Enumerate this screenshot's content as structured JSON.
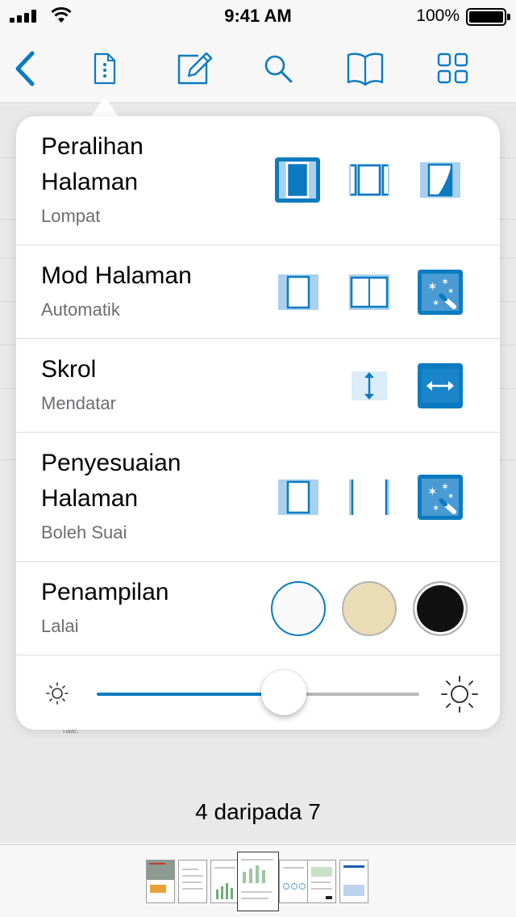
{
  "status_bar": {
    "time": "9:41 AM",
    "battery": "100%"
  },
  "toolbar": {
    "buttons": [
      "back-icon",
      "document-info-icon",
      "annotate-icon",
      "search-icon",
      "bookmark-icon",
      "thumbnails-grid-icon"
    ]
  },
  "view_settings": {
    "rows": [
      {
        "title_line1": "Peralihan",
        "title_line2": "Halaman",
        "value": "Lompat",
        "options": [
          "jump",
          "continuous",
          "page-curl"
        ],
        "selected": 0
      },
      {
        "title_line1": "Mod Halaman",
        "title_line2": "",
        "value": "Automatik",
        "options": [
          "single-page",
          "double-page",
          "automatic"
        ],
        "selected": 2
      },
      {
        "title_line1": "Skrol",
        "title_line2": "",
        "value": "Mendatar",
        "options": [
          "vertical",
          "horizontal"
        ],
        "selected": 1
      },
      {
        "title_line1": "Penyesuaian",
        "title_line2": "Halaman",
        "value": "Boleh Suai",
        "options": [
          "fit-page",
          "fit-width",
          "adaptive"
        ],
        "selected": 2
      },
      {
        "title_line1": "Penampilan",
        "title_line2": "",
        "value": "Lalai",
        "options": [
          "default-white",
          "sepia",
          "night"
        ],
        "selected": 0
      }
    ],
    "brightness": 0.58
  },
  "document": {
    "rate_text": "rate."
  },
  "pager": {
    "label": "4 daripada 7",
    "current": 4,
    "total": 7
  },
  "colors": {
    "accent": "#0a7bc1",
    "accent_light": "#a9d1ee",
    "sepia": "#eadcb5",
    "night": "#111111"
  }
}
